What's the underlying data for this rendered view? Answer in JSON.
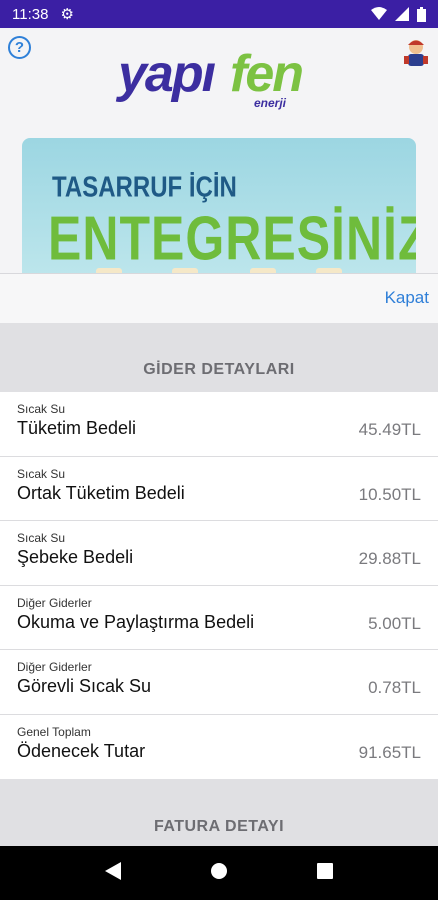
{
  "status_bar": {
    "time": "11:38"
  },
  "header": {
    "logo_main": "yapı",
    "logo_accent": "fen",
    "logo_sub": "enerji",
    "help_label": "?"
  },
  "banner": {
    "line1": "TASARRUF İÇİN",
    "line2": "ENTEGRESİNİZ!"
  },
  "close_label": "Kapat",
  "expense_section": {
    "title": "GİDER DETAYLARI",
    "rows": [
      {
        "category": "Sıcak Su",
        "name": "Tüketim Bedeli",
        "amount": "45.49TL"
      },
      {
        "category": "Sıcak Su",
        "name": "Ortak Tüketim Bedeli",
        "amount": "10.50TL"
      },
      {
        "category": "Sıcak Su",
        "name": "Şebeke Bedeli",
        "amount": "29.88TL"
      },
      {
        "category": "Diğer Giderler",
        "name": "Okuma ve Paylaştırma Bedeli",
        "amount": "5.00TL"
      },
      {
        "category": "Diğer Giderler",
        "name": "Görevli Sıcak Su",
        "amount": "0.78TL"
      },
      {
        "category": "Genel Toplam",
        "name": "Ödenecek Tutar",
        "amount": "91.65TL"
      }
    ]
  },
  "invoice_section": {
    "title": "FATURA DETAYI"
  },
  "colors": {
    "status_bar": "#3b1fa4",
    "brand_purple": "#3c2ea0",
    "brand_green": "#7cc242",
    "link_blue": "#2f7fd8"
  }
}
